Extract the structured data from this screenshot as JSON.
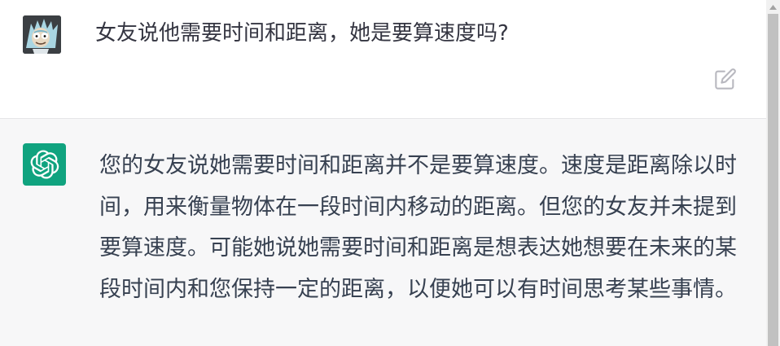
{
  "conversation": {
    "user_message": {
      "text": "女友说他需要时间和距离，她是要算速度吗?",
      "avatar_icon": "rick-avatar-icon",
      "edit_icon": "edit-icon"
    },
    "assistant_message": {
      "text": "您的女友说她需要时间和距离并不是要算速度。速度是距离除以时间，用来衡量物体在一段时间内移动的距离。但您的女友并未提到要算速度。可能她说她需要时间和距离是想表达她想要在未来的某段时间内和您保持一定的距离，以便她可以有时间思考某些事情。",
      "avatar_icon": "openai-logo-icon",
      "avatar_color": "#10a37f"
    }
  },
  "colors": {
    "user_background": "#ffffff",
    "assistant_background": "#f7f7f8",
    "text": "#374151"
  }
}
